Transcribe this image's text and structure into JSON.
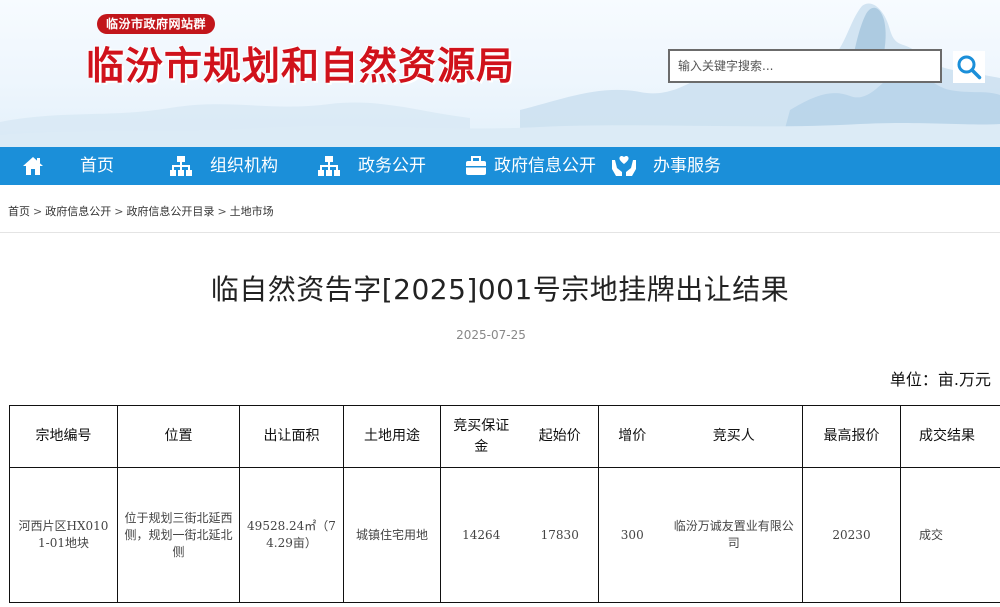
{
  "header": {
    "tag": "临汾市政府网站群",
    "title": "临汾市规划和自然资源局",
    "search_placeholder": "输入关键字搜索..."
  },
  "icons": {
    "search": "search-icon",
    "home": "home-icon",
    "org": "org-chart-icon",
    "gov_affairs": "org-chart-icon",
    "gov_info": "briefcase-icon",
    "services": "hands-icon"
  },
  "nav": {
    "items": [
      {
        "label": "首页"
      },
      {
        "label": "组织机构"
      },
      {
        "label": "政务公开"
      },
      {
        "label": "政府信息公开"
      },
      {
        "label": "办事服务"
      }
    ]
  },
  "breadcrumb": {
    "items": [
      "首页",
      "政府信息公开",
      "政府信息公开目录",
      "土地市场"
    ],
    "separator": ">"
  },
  "article": {
    "title": "临自然资告字[2025]001号宗地挂牌出让结果",
    "date": "2025-07-25",
    "unit": "单位：亩.万元"
  },
  "table": {
    "headers": [
      "宗地编号",
      "位置",
      "出让面积",
      "土地用途",
      "竞买保证金",
      "起始价",
      "增价",
      "竞买人",
      "最高报价",
      "成交结果"
    ],
    "rows": [
      {
        "parcel_id": "河西片区HX0101-01地块",
        "location": "位于规划三街北延西侧，规划一街北延北侧",
        "area": "49528.24㎡（74.29亩）",
        "land_use": "城镇住宅用地",
        "deposit": "14264",
        "start_price": "17830",
        "increment": "300",
        "bidder": "临汾万诚友置业有限公司",
        "highest_bid": "20230",
        "result": "成交"
      }
    ]
  },
  "colors": {
    "nav_bg": "#1b8fd9",
    "title_red": "#d0121b",
    "tag_red": "#c2161b"
  }
}
